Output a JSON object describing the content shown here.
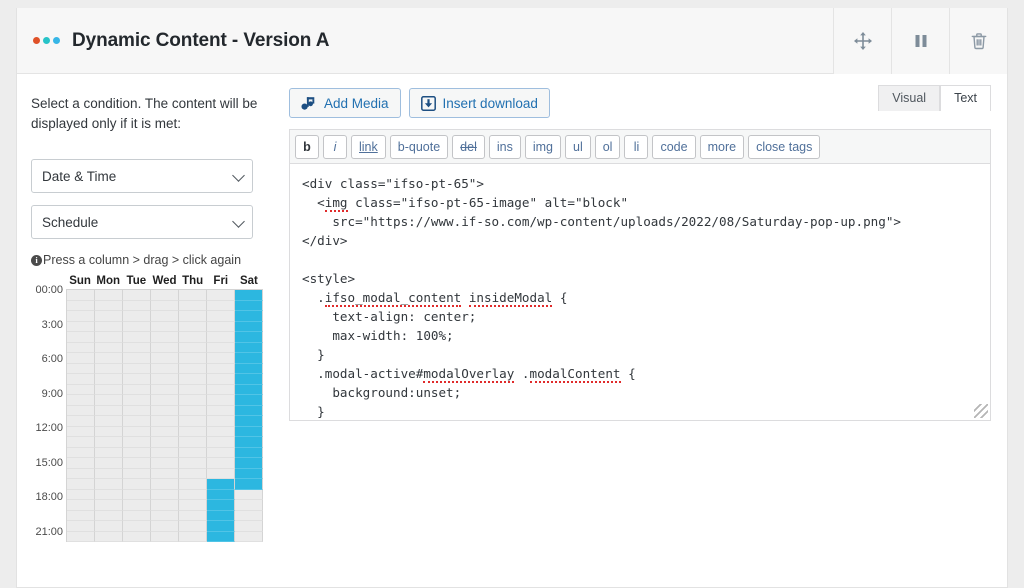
{
  "header": {
    "title": "Dynamic Content - Version A",
    "logo_dots": [
      "#df5128",
      "#27c3c8",
      "#37b6e6"
    ],
    "actions": [
      {
        "name": "move-icon",
        "label": "Move"
      },
      {
        "name": "pause-icon",
        "label": "Pause"
      },
      {
        "name": "trash-icon",
        "label": "Delete"
      }
    ]
  },
  "sidebar": {
    "condition_note": "Select a condition. The content will be displayed only if it is met:",
    "condition_select": {
      "value": "Date & Time"
    },
    "subcondition_select": {
      "value": "Schedule"
    },
    "hint": "Press a column > drag > click again",
    "hint_icon": "info-icon"
  },
  "schedule": {
    "days": [
      "Sun",
      "Mon",
      "Tue",
      "Wed",
      "Thu",
      "Fri",
      "Sat"
    ],
    "time_labels": [
      "00:00",
      "3:00",
      "6:00",
      "9:00",
      "12:00",
      "15:00",
      "18:00",
      "21:00"
    ],
    "rows": 24,
    "selected_color": "#2cb7e0",
    "empty_color": "#ececec",
    "selection": {
      "Sun": [],
      "Mon": [],
      "Tue": [],
      "Wed": [],
      "Thu": [],
      "Fri": [
        18,
        19,
        20,
        21,
        22,
        23
      ],
      "Sat": [
        0,
        1,
        2,
        3,
        4,
        5,
        6,
        7,
        8,
        9,
        10,
        11,
        12,
        13,
        14,
        15,
        16,
        17,
        18
      ]
    }
  },
  "editor": {
    "media_buttons": [
      {
        "label": "Add Media",
        "icon": "add-media-icon"
      },
      {
        "label": "Insert download",
        "icon": "download-icon"
      }
    ],
    "tabs": [
      {
        "label": "Visual",
        "active": false
      },
      {
        "label": "Text",
        "active": true
      }
    ],
    "quicktags": [
      "b",
      "i",
      "link",
      "b-quote",
      "del",
      "ins",
      "img",
      "ul",
      "ol",
      "li",
      "code",
      "more",
      "close tags"
    ],
    "code": "<div class=\"ifso-pt-65\">\n  <img class=\"ifso-pt-65-image\" alt=\"block\"\n    src=\"https://www.if-so.com/wp-content/uploads/2022/08/Saturday-pop-up.png\">\n</div>\n\n<style>\n  .ifso_modal_content insideModal {\n    text-align: center;\n    max-width: 100%;\n  }\n  .modal-active#modalOverlay .modalContent {\n    background:unset;\n  }\n  }"
  }
}
